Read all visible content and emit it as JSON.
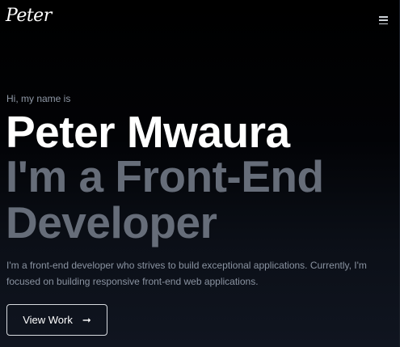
{
  "header": {
    "logo_text": "Peter",
    "menu_icon": "hamburger-menu-icon"
  },
  "hero": {
    "greeting": "Hi, my name is",
    "name": "Peter Mwaura",
    "role": "I'm a Front-End Developer",
    "description": "I'm a front-end developer who strives to build exceptional applications. Currently, I'm focused on building responsive front-end web applications.",
    "cta_label": "View Work",
    "cta_icon": "arrow-right-icon"
  },
  "colors": {
    "background": "#000000",
    "name_text": "#ffffff",
    "role_text": "#666d79",
    "muted_text": "#8a93a1"
  }
}
